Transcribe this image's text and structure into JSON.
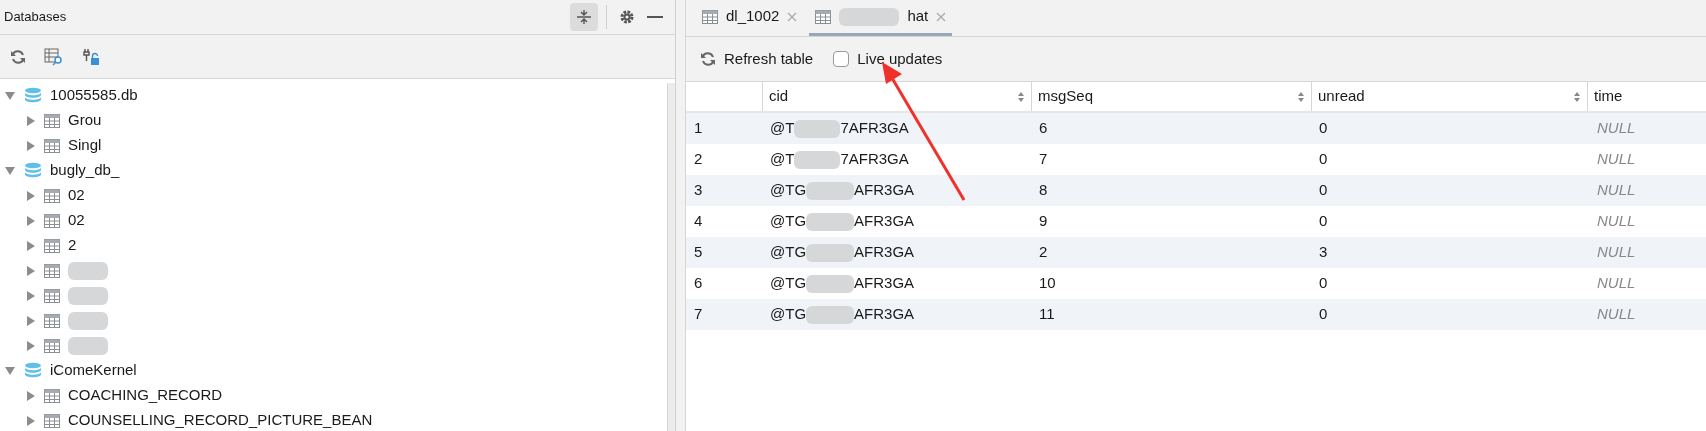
{
  "databases_panel": {
    "title": "Databases",
    "tree": [
      {
        "label": "10055585.db",
        "kind": "database",
        "expanded": true,
        "children": [
          {
            "label": "Grou",
            "kind": "table",
            "expanded": false
          },
          {
            "label": "Singl",
            "kind": "table",
            "expanded": false
          }
        ]
      },
      {
        "label": "bugly_db_",
        "kind": "database",
        "expanded": true,
        "children": [
          {
            "label": "02",
            "kind": "table",
            "expanded": false
          },
          {
            "label": "02",
            "kind": "table",
            "expanded": false
          },
          {
            "label": "2",
            "kind": "table",
            "expanded": false
          },
          {
            "kind": "table",
            "expanded": false
          },
          {
            "kind": "table",
            "expanded": false
          },
          {
            "kind": "table",
            "expanded": false
          },
          {
            "kind": "table",
            "expanded": false
          }
        ]
      },
      {
        "label": "iComeKernel",
        "kind": "database",
        "expanded": true,
        "children": [
          {
            "label": "COACHING_RECORD",
            "kind": "table",
            "expanded": false
          },
          {
            "label": "COUNSELLING_RECORD_PICTURE_BEAN",
            "kind": "table",
            "expanded": false
          }
        ]
      }
    ]
  },
  "tabs": [
    {
      "label": "dl_1002",
      "selected": false
    },
    {
      "label": "hat",
      "selected": true
    }
  ],
  "toolbar": {
    "refresh": "Refresh table",
    "live_updates": {
      "label": "Live updates",
      "checked": false
    }
  },
  "table": {
    "columns": [
      {
        "label": "cid",
        "sortable": true
      },
      {
        "label": "msgSeq",
        "sortable": true
      },
      {
        "label": "unread",
        "sortable": true
      },
      {
        "label": "time",
        "sortable": false
      }
    ],
    "rows": [
      {
        "index": "1",
        "cid_start": "@T",
        "cid_end": "7AFR3GA",
        "msgSeq": "6",
        "unread": "0",
        "time": "NULL"
      },
      {
        "index": "2",
        "cid_start": "@T",
        "cid_end": "7AFR3GA",
        "msgSeq": "7",
        "unread": "0",
        "time": "NULL"
      },
      {
        "index": "3",
        "cid_start": "@TG",
        "cid_end": "AFR3GA",
        "msgSeq": "8",
        "unread": "0",
        "time": "NULL"
      },
      {
        "index": "4",
        "cid_start": "@TG",
        "cid_end": "AFR3GA",
        "msgSeq": "9",
        "unread": "0",
        "time": "NULL"
      },
      {
        "index": "5",
        "cid_start": "@TG",
        "cid_end": "AFR3GA",
        "msgSeq": "2",
        "unread": "3",
        "time": "NULL"
      },
      {
        "index": "6",
        "cid_start": "@TG",
        "cid_end": "AFR3GA",
        "msgSeq": "10",
        "unread": "0",
        "time": "NULL"
      },
      {
        "index": "7",
        "cid_start": "@TG",
        "cid_end": "AFR3GA",
        "msgSeq": "11",
        "unread": "0",
        "time": "NULL"
      }
    ]
  }
}
